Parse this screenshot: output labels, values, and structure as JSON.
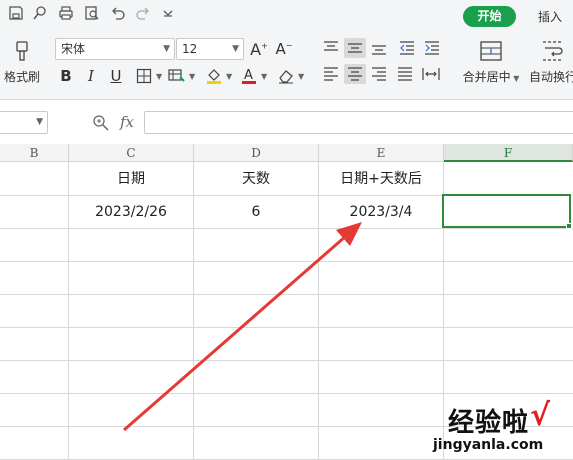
{
  "ribbon": {
    "tabs": {
      "start": "开始",
      "insert": "插入"
    },
    "format_painter": "格式刷",
    "font_name": "宋体",
    "font_size": "12",
    "merge_center": "合并居中",
    "wrap_text": "自动换行",
    "icons": [
      "save-icon",
      "find-icon",
      "print-icon",
      "print-preview-icon",
      "undo-icon",
      "redo-icon",
      "customize-icon"
    ]
  },
  "formula_bar": {
    "fx": "fx",
    "value": ""
  },
  "grid": {
    "columns": [
      "B",
      "C",
      "D",
      "E",
      "F"
    ],
    "selected_column": "F",
    "header_row": {
      "c": "日期",
      "d": "天数",
      "e": "日期+天数后"
    },
    "data_row": {
      "c": "2023/2/26",
      "d": "6",
      "e": "2023/3/4",
      "f": ""
    }
  },
  "watermark": {
    "title": "经验啦",
    "check": "√",
    "url": "jingyanla.com"
  },
  "colors": {
    "accent": "#1aa04c",
    "selection": "#2e8b3e",
    "arrow": "#e53935"
  }
}
